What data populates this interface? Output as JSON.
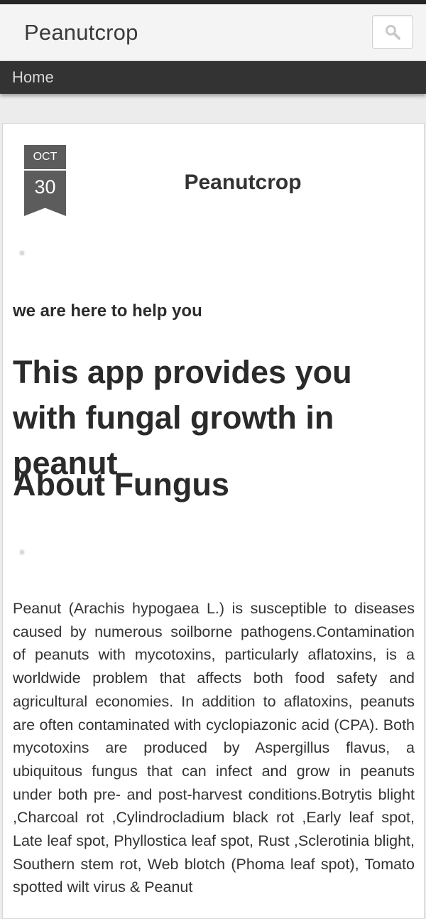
{
  "header": {
    "site_title": "Peanutcrop",
    "search_icon": "search-icon"
  },
  "nav": {
    "items": [
      {
        "label": "Home"
      }
    ]
  },
  "post": {
    "date": {
      "month": "OCT",
      "day": "30"
    },
    "title": "Peanutcrop",
    "tagline": "we are here to help you",
    "heading_main": "This app provides you with fungal growth in peanut",
    "heading_about": "About Fungus",
    "body": "Peanut (Arachis hypogaea L.) is susceptible to diseases caused by numerous soilborne pathogens.Contamination of peanuts with mycotoxins, particularly aflatoxins, is a worldwide problem that affects both food safety and agricultural economies. In addition to aflatoxins, peanuts are often contaminated with cyclopiazonic acid (CPA). Both mycotoxins are produced by Aspergillus flavus, a ubiquitous fungus that can infect and grow in peanuts under both pre- and post-harvest conditions.Botrytis blight ,Charcoal rot ,Cylindrocladium black rot ,Early leaf spot, Late leaf spot, Phyllostica leaf spot, Rust ,Sclerotinia blight, Southern stem rot, Web blotch (Phoma leaf spot), Tomato spotted wilt virus & Peanut"
  }
}
